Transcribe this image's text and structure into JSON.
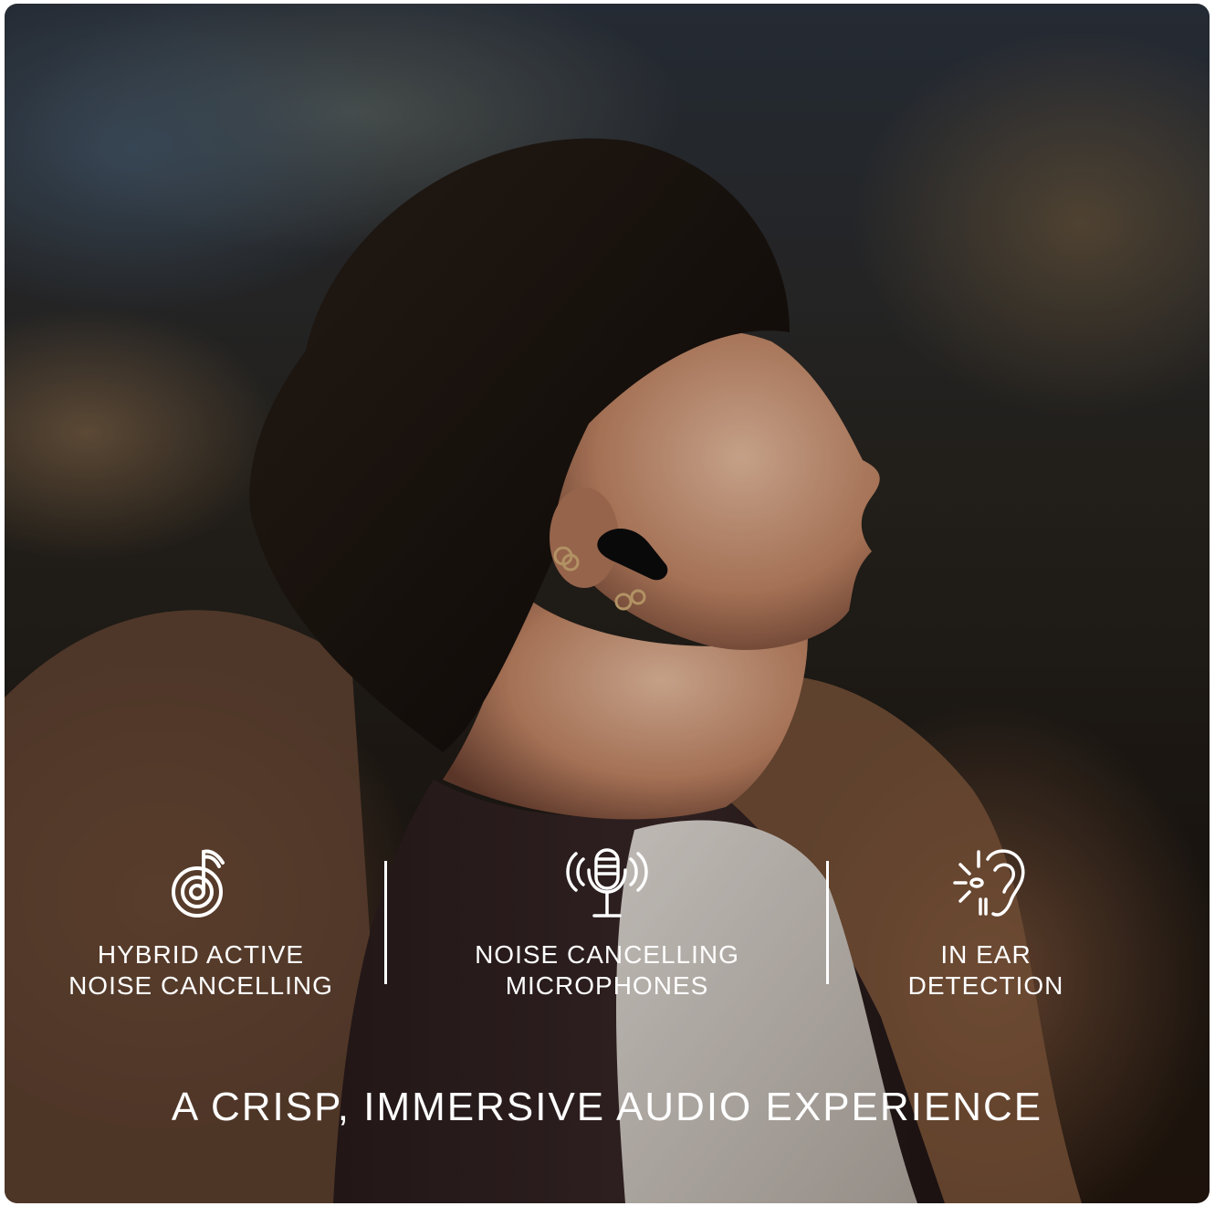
{
  "features": [
    {
      "icon": "music-note-icon",
      "label": "HYBRID ACTIVE\nNOISE CANCELLING"
    },
    {
      "icon": "microphone-icon",
      "label": "NOISE CANCELLING\nMICROPHONES"
    },
    {
      "icon": "ear-detection-icon",
      "label": "IN EAR\nDETECTION"
    }
  ],
  "headline": "A CRISP, IMMERSIVE AUDIO EXPERIENCE",
  "colors": {
    "text": "#ffffff",
    "background": "#ffffff"
  }
}
